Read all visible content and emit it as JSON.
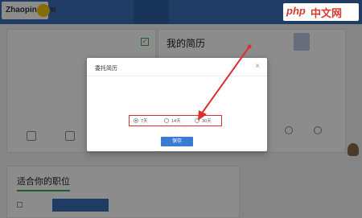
{
  "logo": {
    "text": "Zhaopin.com"
  },
  "nav": {
    "items": [
      "",
      "",
      "",
      "",
      "",
      ""
    ],
    "active_index": 1
  },
  "profile": {
    "name": "",
    "meta": "",
    "info_lines": [
      "",
      "",
      ""
    ],
    "shortcuts": [
      "",
      ""
    ]
  },
  "resume": {
    "title": "我的简历",
    "settings_link": "",
    "actions": [
      "",
      ""
    ]
  },
  "jobs": {
    "title": "适合你的职位",
    "check_label": "",
    "button_label": ""
  },
  "modal": {
    "title": "委托简历",
    "close": "×",
    "description": "",
    "status": "",
    "options_label": "",
    "options": [
      "7天",
      "14天",
      "30天"
    ],
    "selected_index": 0,
    "save_label": "保存"
  },
  "watermark": {
    "logo": "php",
    "text": "中文网"
  },
  "colors": {
    "nav": "#3a6fb6",
    "accent": "#34a853",
    "highlight": "#d9312b",
    "primary_button": "#3a7bd5"
  },
  "icons": [
    "check-icon",
    "trash-icon",
    "close-icon",
    "radio-icon",
    "arrow-annotation"
  ]
}
